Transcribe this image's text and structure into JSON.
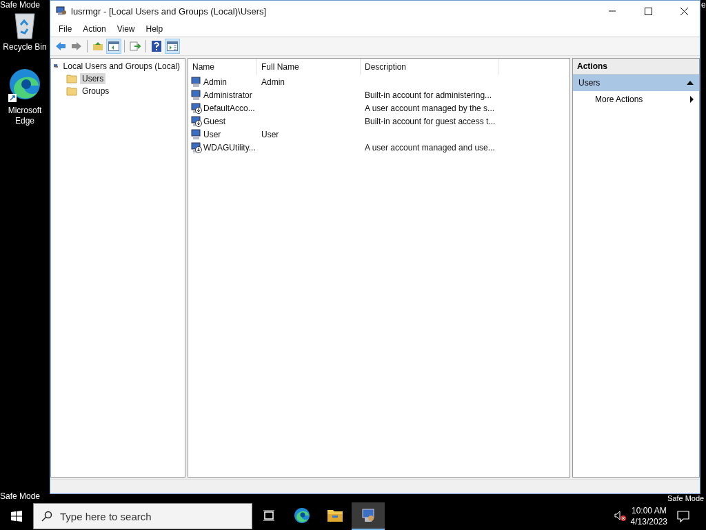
{
  "desktop": {
    "watermarks": [
      "Safe Mode",
      "e",
      "Safe Mode",
      "Safe Mode"
    ],
    "icons": [
      {
        "kind": "recycle",
        "label": "Recycle Bin"
      },
      {
        "kind": "edge",
        "label": "Microsoft Edge"
      }
    ]
  },
  "window": {
    "title": "lusrmgr - [Local Users and Groups (Local)\\Users]"
  },
  "menu": [
    "File",
    "Action",
    "View",
    "Help"
  ],
  "toolbar": [
    {
      "kind": "back",
      "on": false
    },
    {
      "kind": "forward",
      "on": false
    },
    {
      "kind": "up",
      "on": false
    },
    {
      "kind": "tree",
      "on": true
    },
    {
      "kind": "export",
      "on": false
    },
    {
      "kind": "help",
      "on": false
    },
    {
      "kind": "actions",
      "on": true
    }
  ],
  "tree": {
    "label": "Local Users and Groups (Local)",
    "children": [
      {
        "label": "Users",
        "selected": true
      },
      {
        "label": "Groups",
        "selected": false
      }
    ]
  },
  "list": {
    "columns": [
      "Name",
      "Full Name",
      "Description"
    ],
    "rows": [
      {
        "name": "Admin",
        "full_name": "Admin",
        "description": "",
        "disabled": false
      },
      {
        "name": "Administrator",
        "full_name": "",
        "description": "Built-in account for administering...",
        "disabled": false
      },
      {
        "name": "DefaultAcco...",
        "full_name": "",
        "description": "A user account managed by the s...",
        "disabled": true
      },
      {
        "name": "Guest",
        "full_name": "",
        "description": "Built-in account for guest access t...",
        "disabled": true
      },
      {
        "name": "User",
        "full_name": "User",
        "description": "",
        "disabled": false
      },
      {
        "name": "WDAGUtility...",
        "full_name": "",
        "description": "A user account managed and use...",
        "disabled": true
      }
    ]
  },
  "actions": {
    "title": "Actions",
    "section": {
      "label": "Users",
      "expanded": true
    },
    "items": [
      "More Actions"
    ]
  },
  "taskbar": {
    "search": {
      "placeholder": "Type here to search"
    },
    "apps": [
      {
        "kind": "taskview",
        "selected": false
      },
      {
        "kind": "edge",
        "selected": false
      },
      {
        "kind": "explorer",
        "selected": false
      },
      {
        "kind": "mmc",
        "selected": true
      }
    ],
    "time": "10:00 AM",
    "date": "4/13/2023"
  }
}
